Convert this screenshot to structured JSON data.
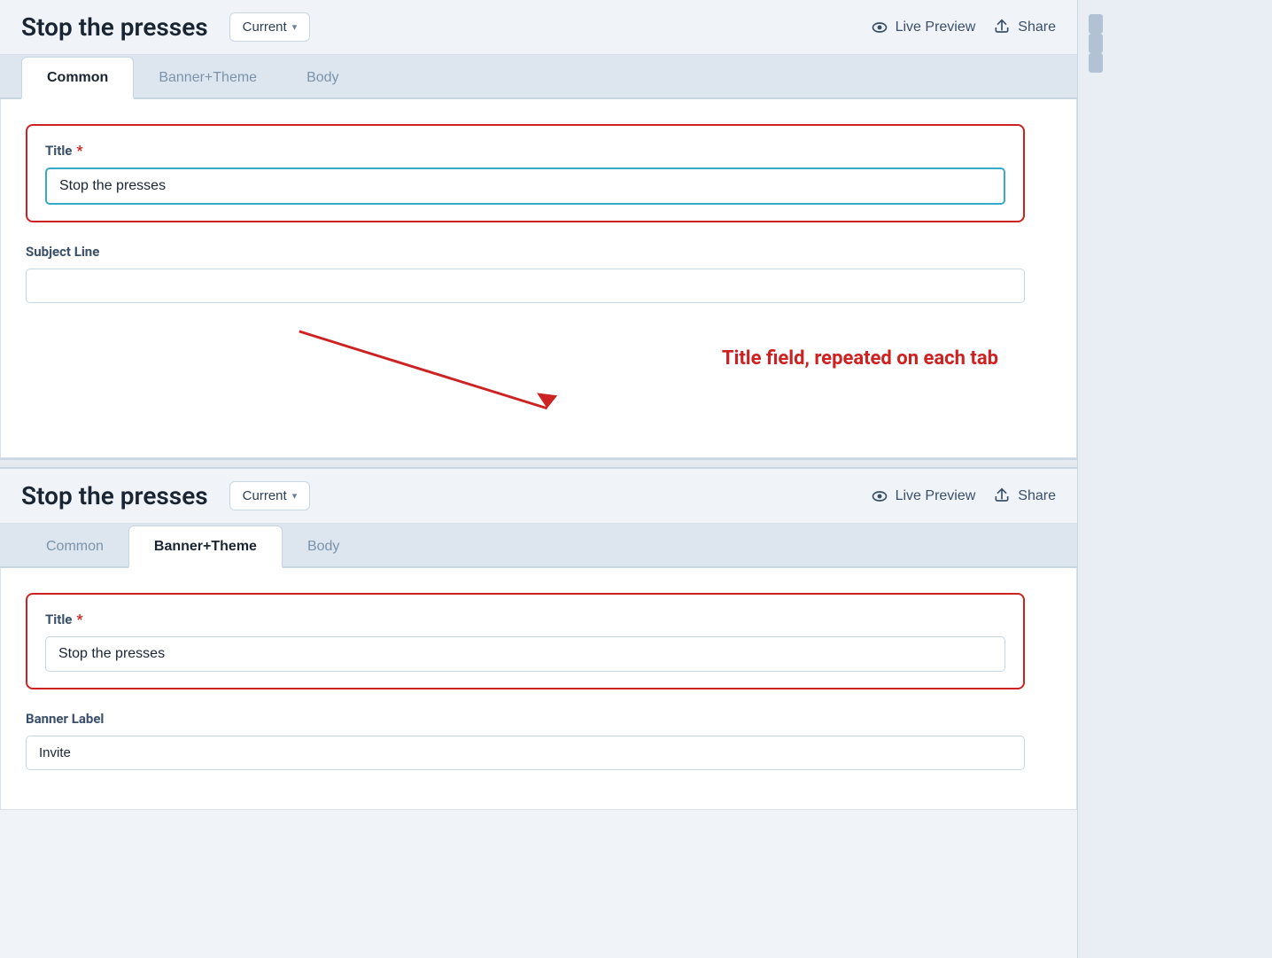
{
  "panels": [
    {
      "id": "panel-top",
      "header": {
        "title": "Stop the presses",
        "current_label": "Current",
        "live_preview_label": "Live Preview",
        "share_label": "Share"
      },
      "tabs": [
        {
          "id": "common",
          "label": "Common",
          "active": true
        },
        {
          "id": "banner-theme",
          "label": "Banner+Theme",
          "active": false
        },
        {
          "id": "body",
          "label": "Body",
          "active": false
        }
      ],
      "fields": {
        "title": {
          "label": "Title",
          "required": true,
          "value": "Stop the presses",
          "active": true
        },
        "subject_line": {
          "label": "Subject Line",
          "value": ""
        }
      }
    },
    {
      "id": "panel-bottom",
      "header": {
        "title": "Stop the presses",
        "current_label": "Current",
        "live_preview_label": "Live Preview",
        "share_label": "Share"
      },
      "tabs": [
        {
          "id": "common",
          "label": "Common",
          "active": false
        },
        {
          "id": "banner-theme",
          "label": "Banner+Theme",
          "active": true
        },
        {
          "id": "body",
          "label": "Body",
          "active": false
        }
      ],
      "fields": {
        "title": {
          "label": "Title",
          "required": true,
          "value": "Stop the presses",
          "active": false
        },
        "banner_label": {
          "label": "Banner Label",
          "value": "Invite"
        }
      }
    }
  ],
  "annotation": {
    "text": "Title field, repeated on each tab"
  },
  "required_star": "*"
}
